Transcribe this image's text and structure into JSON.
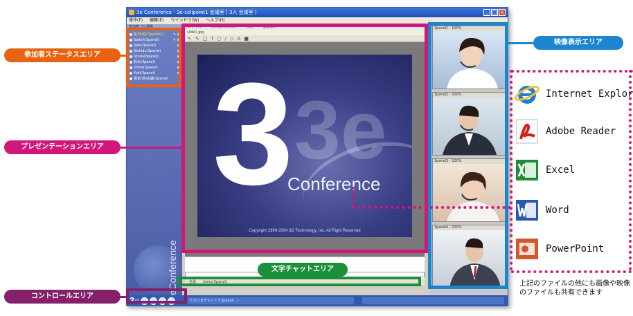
{
  "window": {
    "title": "3e Conference - 3e-cellpoint1 会議室 [ 3人 会議室 ]",
    "menu": [
      "操作(F)",
      "編集(E)",
      "ウインドウ(W)",
      "ヘルプ(H)"
    ]
  },
  "participants": {
    "tabs": "参加者 (5) 閲覧",
    "items": [
      {
        "name": "金沢(他)(3panel1)",
        "highlight": true
      },
      {
        "name": "Saitoh(3panel)",
        "highlight": false
      },
      {
        "name": "Sato(3panel)",
        "highlight": false
      },
      {
        "name": "Nishida(3panel)",
        "highlight": false
      },
      {
        "name": "Ishida(3panel)",
        "highlight": false
      },
      {
        "name": "鈴木(3panel)",
        "highlight": false
      },
      {
        "name": "Ichiro(3panel)",
        "highlight": false
      },
      {
        "name": "Yuki(3panel)",
        "highlight": false
      },
      {
        "name": "塚本(他)会議(3panel)",
        "highlight": false
      }
    ]
  },
  "presentation": {
    "doc_tabs": [
      "ファイル",
      "3e Conference",
      "資料",
      "画像保存"
    ],
    "file_name": "slide1.jpg",
    "slide": {
      "big_text": "3",
      "ghost_text": "3e",
      "brand": "Conference",
      "copyright": "Copyright 1999-2004 3i2 Technology, Inc. All Right Reserved"
    },
    "chat_tabs": [
      "全員",
      "Ichiro(3panel)"
    ]
  },
  "brand_vertical": "3eConference",
  "statusbar": {
    "text": "ただいまチャットで3panel(...)"
  },
  "video": {
    "tiles": [
      {
        "header": "3panel1 - 100%"
      },
      {
        "header": "3panel2 - 100%"
      },
      {
        "header": "3panel3 - 100%"
      },
      {
        "header": "3panel4 - 100%"
      }
    ]
  },
  "callouts": {
    "status": "参加者ステータスエリア",
    "presentation": "プレゼンテーションエリア",
    "control": "コントロールエリア",
    "chat": "文字チャットエリア",
    "video": "映像表示エリア"
  },
  "file_types": [
    {
      "label": "Internet Explorer",
      "icon": "internet-explorer-icon"
    },
    {
      "label": "Adobe Reader",
      "icon": "adobe-reader-icon"
    },
    {
      "label": "Excel",
      "icon": "excel-icon"
    },
    {
      "label": "Word",
      "icon": "word-icon"
    },
    {
      "label": "PowerPoint",
      "icon": "powerpoint-icon"
    }
  ],
  "note": "上記のファイルの他にも画像や映像のファイルも共有できます",
  "colors": {
    "status": "#e8620f",
    "presentation": "#d2177a",
    "control": "#85206b",
    "chat": "#1c8f3a",
    "video": "#1b86cf"
  }
}
